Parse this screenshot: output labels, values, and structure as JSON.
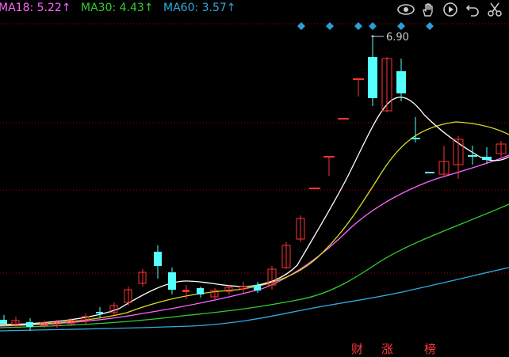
{
  "legend": {
    "ma18_label": "MA18: 5.22↑",
    "ma30_label": "MA30: 4.43↑",
    "ma60_label": "MA60: 3.57↑"
  },
  "colors": {
    "ma18": "#ff66ff",
    "ma30": "#33cc33",
    "ma60": "#33aadd",
    "up": "#ff3333",
    "down": "#55ffff",
    "gridline": "#b00000"
  },
  "high_marker": "6.90",
  "toolbar": {
    "icons": [
      "eye-icon",
      "hand-icon",
      "play-icon",
      "undo-icon",
      "scissors-icon"
    ]
  },
  "bottom_tags": [
    "财",
    "涨",
    "榜"
  ]
}
